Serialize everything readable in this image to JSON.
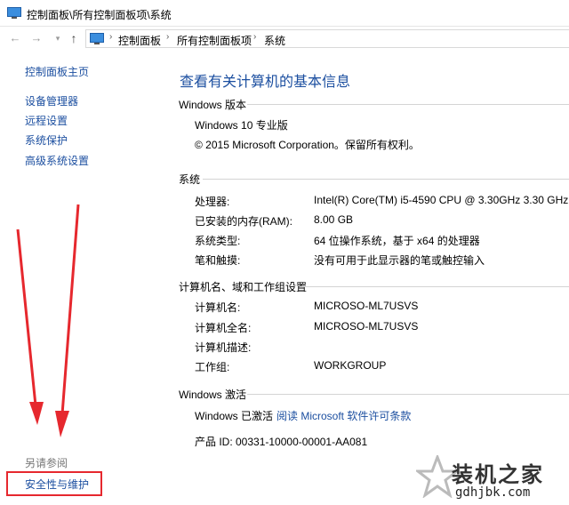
{
  "window": {
    "title": "控制面板\\所有控制面板项\\系统"
  },
  "nav": {
    "back_glyph": "←",
    "forward_glyph": "→",
    "dropdown_glyph": "▾",
    "up_glyph": "↑",
    "separator_glyph": "›",
    "breadcrumbs": [
      "控制面板",
      "所有控制面板项",
      "系统"
    ]
  },
  "sidebar": {
    "home_label": "控制面板主页",
    "links": [
      "设备管理器",
      "远程设置",
      "系统保护",
      "高级系统设置"
    ],
    "see_also_heading": "另请参阅",
    "see_also_link": "安全性与维护"
  },
  "main": {
    "page_title": "查看有关计算机的基本信息",
    "edition": {
      "heading": "Windows 版本",
      "name": "Windows 10 专业版",
      "copyright": "© 2015 Microsoft Corporation。保留所有权利。"
    },
    "system": {
      "heading": "系统",
      "rows": [
        {
          "label": "处理器:",
          "value": "Intel(R) Core(TM) i5-4590 CPU @ 3.30GHz   3.30 GHz"
        },
        {
          "label": "已安装的内存(RAM):",
          "value": "8.00 GB"
        },
        {
          "label": "系统类型:",
          "value": "64 位操作系统，基于 x64 的处理器"
        },
        {
          "label": "笔和触摸:",
          "value": "没有可用于此显示器的笔或触控输入"
        }
      ]
    },
    "computer": {
      "heading": "计算机名、域和工作组设置",
      "rows": [
        {
          "label": "计算机名:",
          "value": "MICROSO-ML7USVS"
        },
        {
          "label": "计算机全名:",
          "value": "MICROSO-ML7USVS"
        },
        {
          "label": "计算机描述:",
          "value": ""
        },
        {
          "label": "工作组:",
          "value": "WORKGROUP"
        }
      ]
    },
    "activation": {
      "heading": "Windows 激活",
      "status": "Windows 已激活",
      "license_link": "阅读 Microsoft 软件许可条款",
      "product_id": "产品 ID: 00331-10000-00001-AA081"
    }
  },
  "watermark": {
    "cn_text": "装机之家",
    "url_text": "gdhjbk.com"
  },
  "colors": {
    "link": "#1c4fa0",
    "annotation_red": "#e6282e"
  }
}
